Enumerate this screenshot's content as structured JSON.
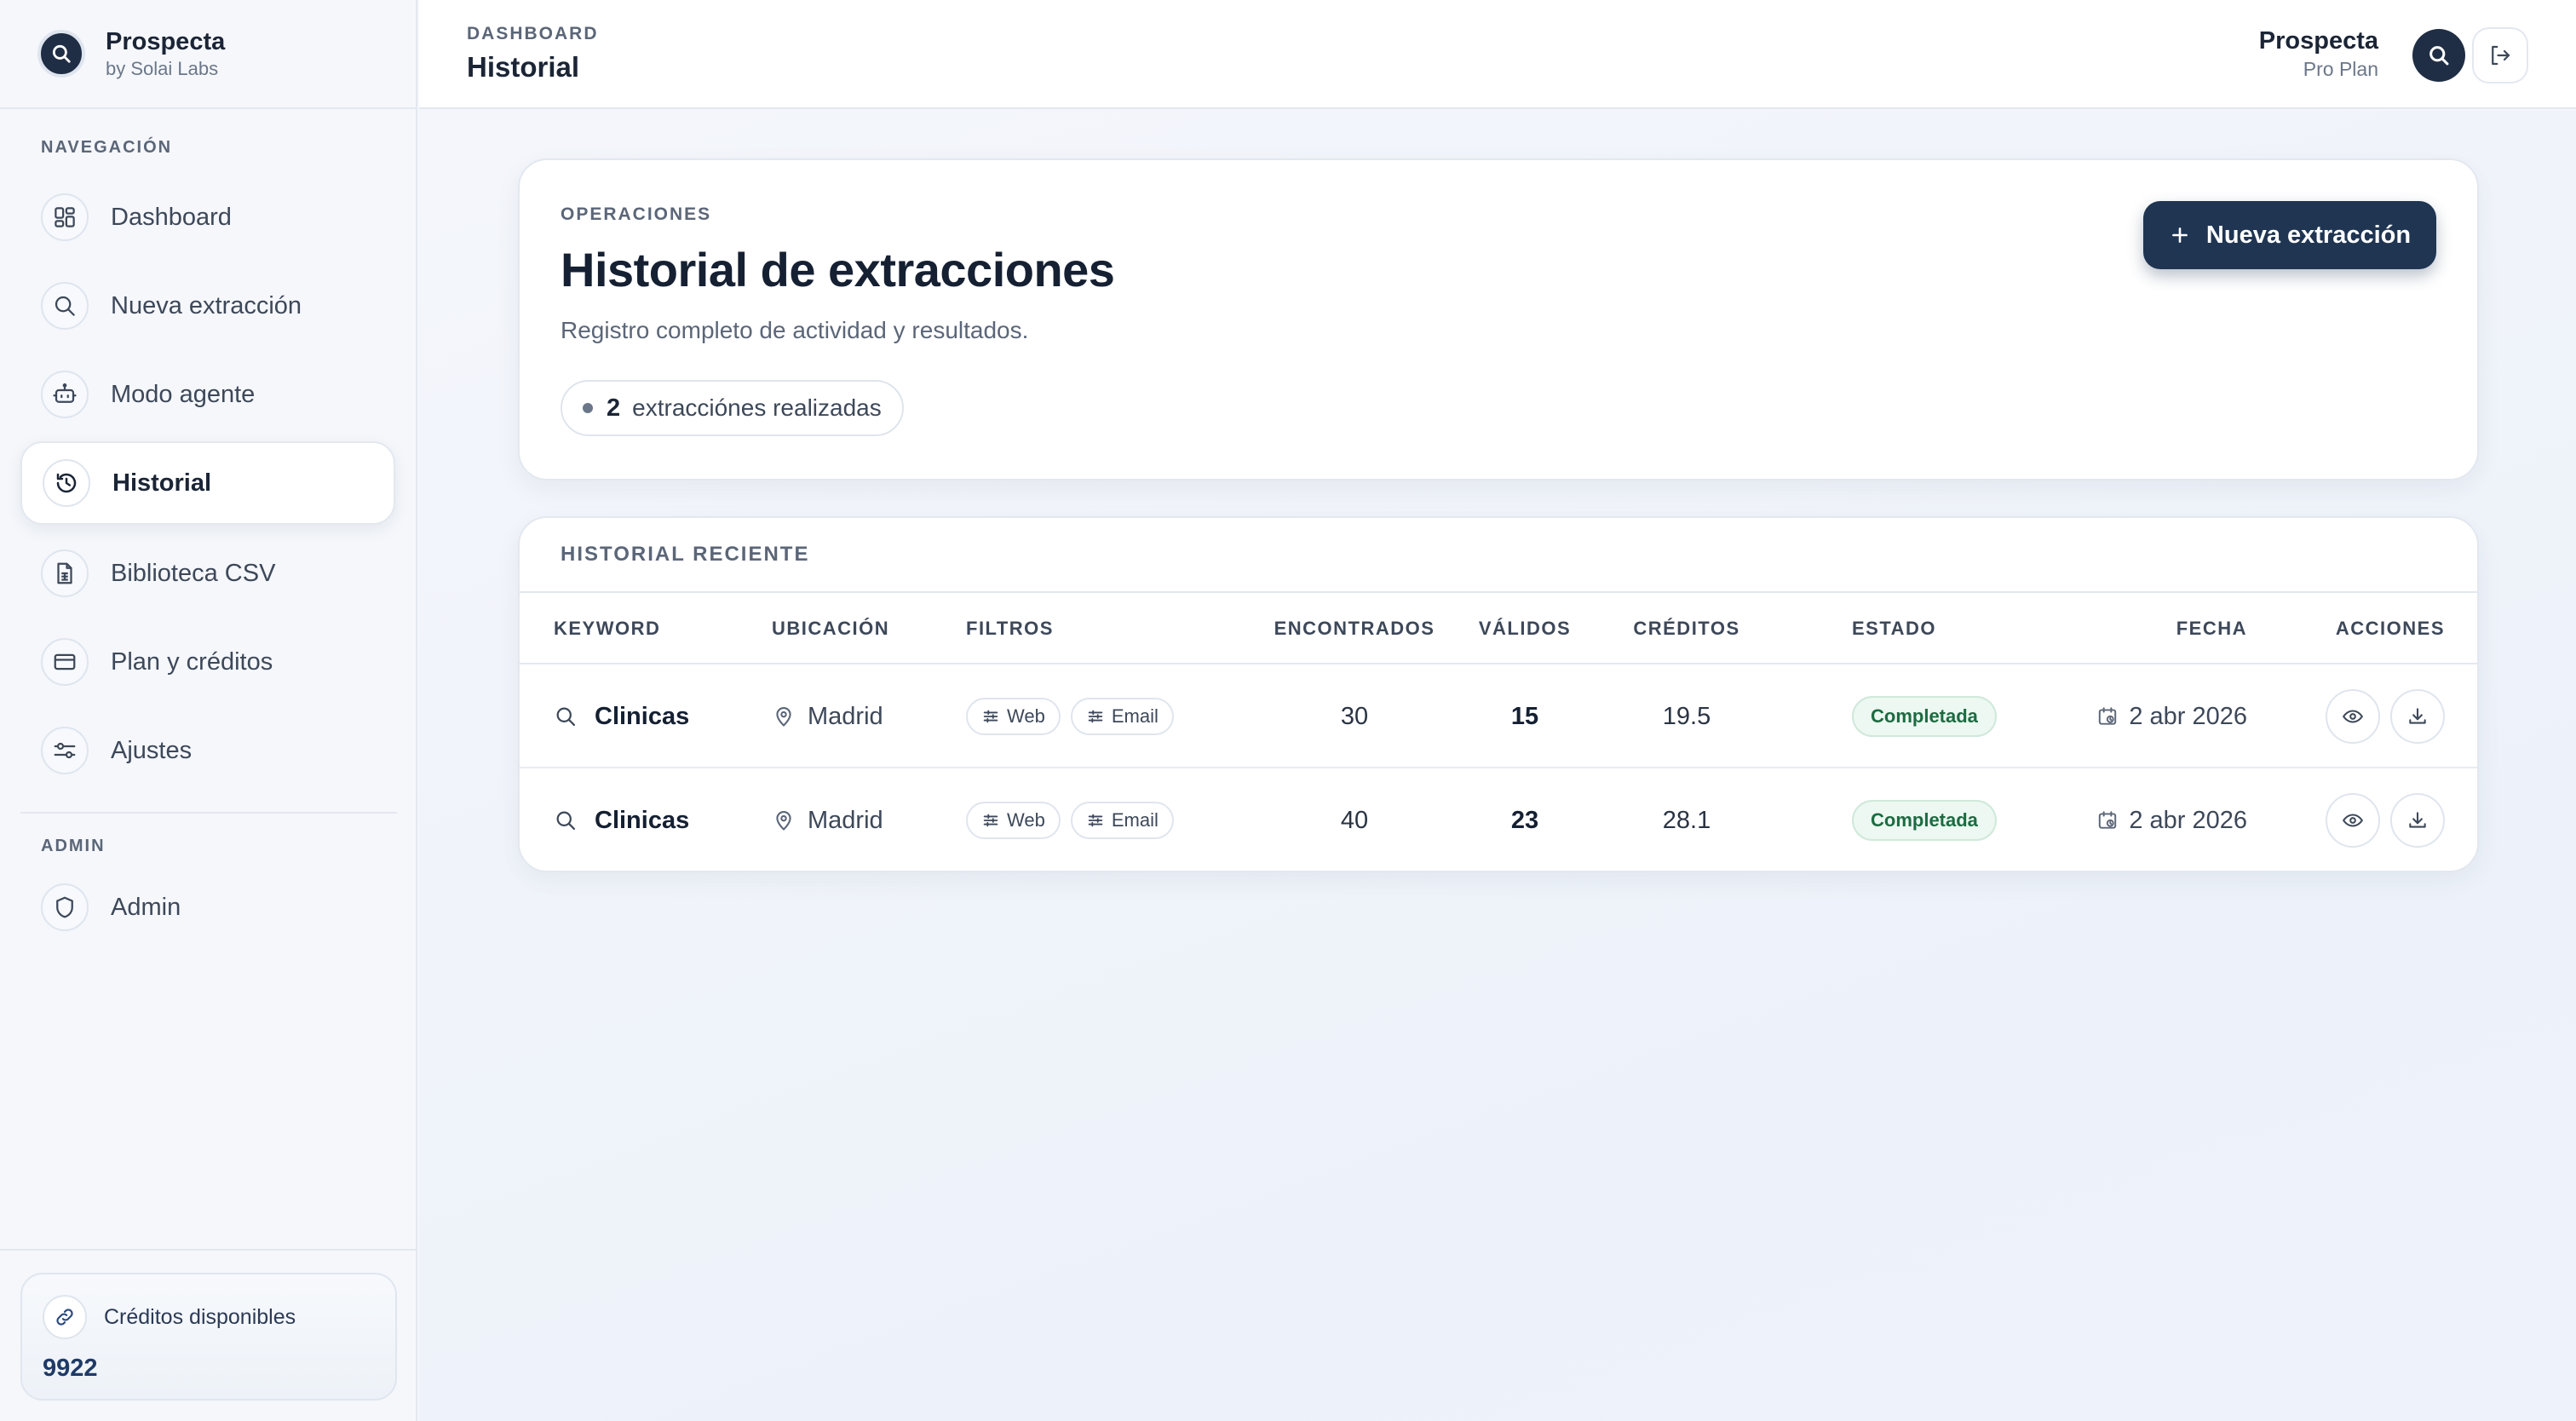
{
  "brand": {
    "name": "Prospecta",
    "sub": "by Solai Labs"
  },
  "nav": {
    "section_main": "NAVEGACIÓN",
    "section_admin": "ADMIN",
    "items": [
      {
        "label": "Dashboard",
        "icon": "dashboard-grid-icon"
      },
      {
        "label": "Nueva extracción",
        "icon": "search-icon"
      },
      {
        "label": "Modo agente",
        "icon": "robot-icon"
      },
      {
        "label": "Historial",
        "icon": "history-icon",
        "active": true
      },
      {
        "label": "Biblioteca CSV",
        "icon": "file-spreadsheet-icon"
      },
      {
        "label": "Plan y créditos",
        "icon": "credit-card-icon"
      },
      {
        "label": "Ajustes",
        "icon": "sliders-icon"
      }
    ],
    "admin": {
      "label": "Admin",
      "icon": "shield-icon"
    }
  },
  "credits": {
    "label": "Créditos disponibles",
    "value": "9922"
  },
  "topbar": {
    "crumb": "DASHBOARD",
    "title": "Historial",
    "user_name": "Prospecta",
    "user_plan": "Pro Plan"
  },
  "hero": {
    "eyebrow": "OPERACIONES",
    "title": "Historial de extracciones",
    "description": "Registro completo de actividad y resultados.",
    "count": "2",
    "count_label": "extracciónes realizadas",
    "new_button": "Nueva extracción"
  },
  "table": {
    "title": "HISTORIAL RECIENTE",
    "headers": {
      "keyword": "KEYWORD",
      "location": "UBICACIÓN",
      "filters": "FILTROS",
      "found": "ENCONTRADOS",
      "valid": "VÁLIDOS",
      "credits": "CRÉDITOS",
      "status": "ESTADO",
      "date": "FECHA",
      "actions": "ACCIONES"
    },
    "rows": [
      {
        "keyword": "Clinicas",
        "location": "Madrid",
        "filters": [
          "Web",
          "Email"
        ],
        "found": "30",
        "valid": "15",
        "credits": "19.5",
        "status": "Completada",
        "date": "2 abr 2026"
      },
      {
        "keyword": "Clinicas",
        "location": "Madrid",
        "filters": [
          "Web",
          "Email"
        ],
        "found": "40",
        "valid": "23",
        "credits": "28.1",
        "status": "Completada",
        "date": "2 abr 2026"
      }
    ]
  },
  "colors": {
    "accent_dark": "#1f3552",
    "status_success_bg": "#ecf8f1",
    "status_success_text": "#1d6b42"
  }
}
